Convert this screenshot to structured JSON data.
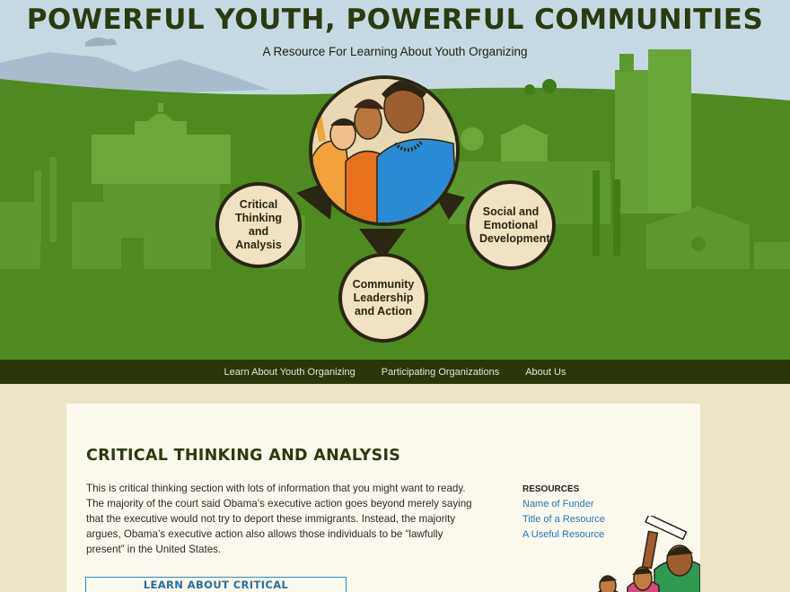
{
  "hero": {
    "title": "Powerful Youth, Powerful Communities",
    "subtitle": "A Resource For Learning About Youth Organizing",
    "bubbles": {
      "critical": "Critical Thinking and Analysis",
      "social": "Social and Emotional Development",
      "community": "Community Leadership and Action"
    },
    "colors": {
      "sky": "#c6d9e3",
      "grass": "#4f8a20",
      "buildings": "#6aa83b",
      "bubble": "#efe3c2"
    }
  },
  "nav": {
    "items": [
      "Learn About Youth Organizing",
      "Participating Organizations",
      "About Us"
    ],
    "background": "#2b3709"
  },
  "section": {
    "title": "Critical Thinking and Analysis",
    "body": "This is critical thinking section with lots of information that you might want to ready. The majority of the court said Obama’s executive action goes beyond merely saying that the executive would not try to deport these immigrants. Instead, the majority argues, Obama’s executive action also allows those individuals to be “lawfully present” in the United States.",
    "button": "Learn About Critical Thinking/Analysis"
  },
  "resources": {
    "heading": "RESOURCES",
    "links": [
      "Name of Funder",
      "Title of a Resource",
      "A Useful Resource"
    ],
    "link_color": "#1f78b4"
  }
}
